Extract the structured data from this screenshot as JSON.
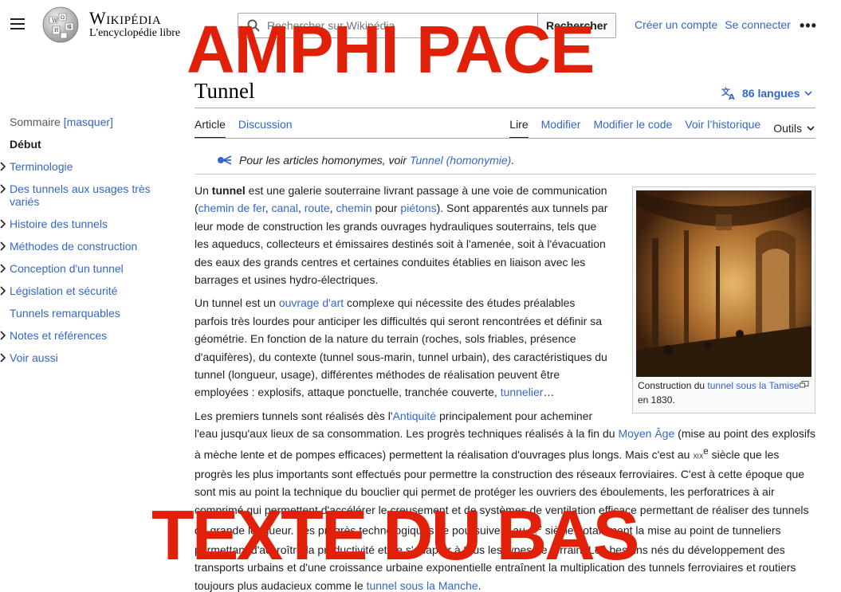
{
  "header": {
    "wordmark": "Wikipédia",
    "tagline": "L'encyclopédie libre",
    "search_placeholder": "Rechercher sur Wikipédia",
    "search_button": "Rechercher",
    "create_account": "Créer un compte",
    "login": "Se connecter"
  },
  "overlays": {
    "top": "AMPHI PACE",
    "bottom": "TEXTE DU BAS"
  },
  "toc": {
    "heading": "Sommaire",
    "toggle": "[masquer]",
    "items": [
      {
        "label": "Début"
      },
      {
        "label": "Terminologie"
      },
      {
        "label": "Des tunnels aux usages très variés"
      },
      {
        "label": "Histoire des tunnels"
      },
      {
        "label": "Méthodes de construction"
      },
      {
        "label": "Conception d'un tunnel"
      },
      {
        "label": "Législation et sécurité"
      },
      {
        "label": "Tunnels remarquables"
      },
      {
        "label": "Notes et références"
      },
      {
        "label": "Voir aussi"
      }
    ]
  },
  "article": {
    "title": "Tunnel",
    "languages": "86 langues",
    "tabs_left": [
      "Article",
      "Discussion"
    ],
    "tabs_right": [
      "Lire",
      "Modifier",
      "Modifier le code",
      "Voir l’historique"
    ],
    "tools": "Outils",
    "hatnote_prefix": "Pour les articles homonymes, voir ",
    "hatnote_link": "Tunnel (homonymie)",
    "hatnote_suffix": ".",
    "figure_caption_prefix": "Construction du ",
    "figure_caption_link": "tunnel sous la Tamise",
    "figure_caption_suffix": " en 1830.",
    "p1": {
      "t0": "Un ",
      "bold": "tunnel",
      "t1": " est une galerie souterraine livrant passage à une voie de communication (",
      "l0": "chemin de fer",
      "t2": ", ",
      "l1": "canal",
      "t3": ", ",
      "l2": "route",
      "t4": ", ",
      "l3": "chemin",
      "t5": " pour ",
      "l4": "piétons",
      "t6": "). Sont apparentés aux tunnels par leur mode de construction les grands ouvrages hydrauliques souterrains, tels que les aqueducs, collecteurs et émissaires destinés soit à l'amenée, soit à l'évacuation des eaux des grands centres et certaines conduites établies en liaison avec les barrages et usines hydro-électriques."
    },
    "p2": {
      "t0": "Un tunnel est un ",
      "l0": "ouvrage d'art",
      "t1": " complexe qui nécessite des études préalables parfois très lourdes pour anticiper les difficultés qui seront rencontrées et définir sa géométrie. En fonction de la nature du terrain (roches, sols friables, présence d'aquifères), du contexte (tunnel sous-marin, tunnel urbain), des caractéristiques du tunnel (longueur, usage), différentes méthodes de réalisation peuvent être employées : explosifs, attaque ponctuelle, tranchée couverte, ",
      "l1": "tunnelier",
      "t2": "…"
    },
    "p3": {
      "t0": "Les premiers tunnels sont réalisés dès l'",
      "l0": "Antiquité",
      "t1": " principalement pour acheminer l'eau jusqu'aux lieux de sa consommation. Les progrès techniques réalisés à la fin du ",
      "l1": "Moyen Âge",
      "t2": " (mise au point des explosifs à mèche lente et de pompes efficaces) permettent la réalisation d'ouvrages plus longs. Mais c'est au ",
      "sc1": "xix",
      "sup1": "e",
      "t3": " siècle que les progrès les plus importants sont effectués pour permettre la construction des réseaux ferroviaires. C'est à cette époque que sont mis au point la technique du bouclier qui permet de protéger les ouvriers des éboulements, les perforatrices à air comprimé qui permettent d'accélérer le creusement et de systèmes de ventilation efficace permettant de réaliser des tunnels de grande longueur. Les progrès technologiques se poursuivent au ",
      "sc2": "xx",
      "sup2": "e",
      "t4": " siècle notamment la mise au point de tunneliers permettant d'accroître la productivité et de s'adapter à tous les types de terrain. Les besoins nés du développement des transports urbains et d'une croissance urbaine exponentielle entraînent la multiplication des tunnels ferroviaires et routiers toujours plus audacieux comme le ",
      "l2": "tunnel sous la Manche",
      "t5": "."
    }
  }
}
